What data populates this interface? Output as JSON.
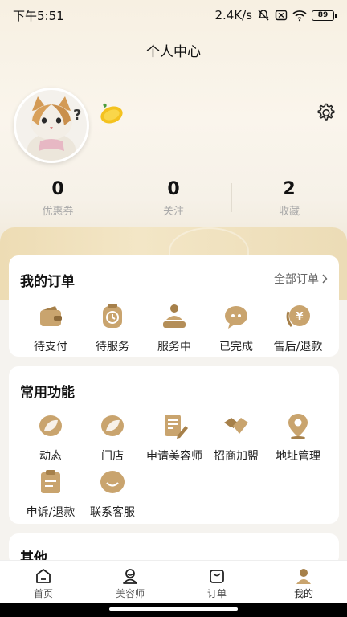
{
  "status_bar": {
    "time": "下午5:51",
    "network_speed": "2.4K/s",
    "battery": "89"
  },
  "header": {
    "title": "个人中心"
  },
  "profile": {
    "username": "?",
    "stats": [
      {
        "value": "0",
        "label": "优惠券"
      },
      {
        "value": "0",
        "label": "关注"
      },
      {
        "value": "2",
        "label": "收藏"
      }
    ]
  },
  "orders": {
    "title": "我的订单",
    "all_link": "全部订单",
    "items": [
      {
        "label": "待支付",
        "icon": "wallet-icon"
      },
      {
        "label": "待服务",
        "icon": "clock-icon"
      },
      {
        "label": "服务中",
        "icon": "massage-icon"
      },
      {
        "label": "已完成",
        "icon": "chat-bubble-icon"
      },
      {
        "label": "售后/退款",
        "icon": "refund-icon"
      }
    ]
  },
  "functions": {
    "title": "常用功能",
    "items": [
      {
        "label": "动态",
        "icon": "leaf-icon"
      },
      {
        "label": "门店",
        "icon": "leaf-icon"
      },
      {
        "label": "申请美容师",
        "icon": "edit-document-icon"
      },
      {
        "label": "招商加盟",
        "icon": "handshake-icon"
      },
      {
        "label": "地址管理",
        "icon": "location-pin-icon"
      },
      {
        "label": "申诉/退款",
        "icon": "clipboard-icon"
      },
      {
        "label": "联系客服",
        "icon": "customer-service-icon"
      }
    ]
  },
  "other": {
    "title": "其他"
  },
  "tabbar": {
    "items": [
      {
        "label": "首页",
        "icon": "home-icon"
      },
      {
        "label": "美容师",
        "icon": "beautician-icon"
      },
      {
        "label": "订单",
        "icon": "order-bag-icon"
      },
      {
        "label": "我的",
        "icon": "profile-icon"
      }
    ],
    "active_index": 3
  },
  "colors": {
    "accent_gold": "#c8a870",
    "icon_gold_dark": "#a6804a",
    "text_primary": "#111111",
    "text_muted": "#a9a9a9"
  }
}
